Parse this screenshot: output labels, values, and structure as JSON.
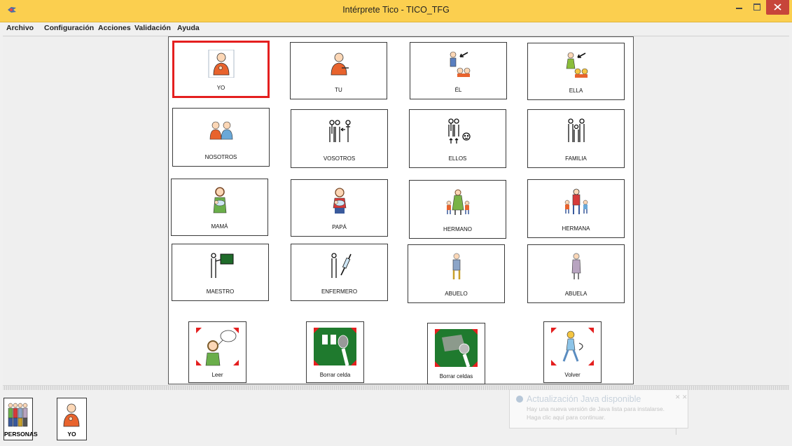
{
  "window": {
    "title": "Intérprete Tico - TICO_TFG"
  },
  "menu": [
    {
      "label": "Archivo"
    },
    {
      "label": "Configuración"
    },
    {
      "label": "Acciones"
    },
    {
      "label": "Validación"
    },
    {
      "label": "Ayuda"
    }
  ],
  "grid": {
    "selected": "YO",
    "cells": [
      {
        "label": "YO",
        "icon": "person-self-icon"
      },
      {
        "label": "TU",
        "icon": "person-you-icon"
      },
      {
        "label": "ÉL",
        "icon": "person-he-icon"
      },
      {
        "label": "ELLA",
        "icon": "person-she-icon"
      },
      {
        "label": "NOSOTROS",
        "icon": "people-we-icon"
      },
      {
        "label": "VOSOTROS",
        "icon": "people-you-plural-icon"
      },
      {
        "label": "ELLOS",
        "icon": "people-they-icon"
      },
      {
        "label": "FAMILIA",
        "icon": "family-icon"
      },
      {
        "label": "MAMÁ",
        "icon": "mother-icon"
      },
      {
        "label": "PAPÁ",
        "icon": "father-icon"
      },
      {
        "label": "HERMANO",
        "icon": "brother-icon"
      },
      {
        "label": "HERMANA",
        "icon": "sister-icon"
      },
      {
        "label": "MAESTRO",
        "icon": "teacher-icon"
      },
      {
        "label": "ENFERMERO",
        "icon": "nurse-icon"
      },
      {
        "label": "ABUELO",
        "icon": "grandfather-icon"
      },
      {
        "label": "ABUELA",
        "icon": "grandmother-icon"
      }
    ],
    "actions": [
      {
        "label": "Leer",
        "icon": "read-aloud-icon"
      },
      {
        "label": "Borrar celda",
        "icon": "delete-cell-icon"
      },
      {
        "label": "Borrar celdas",
        "icon": "delete-cells-icon"
      },
      {
        "label": "Volver",
        "icon": "go-back-icon"
      }
    ]
  },
  "history": [
    {
      "label": "PERSONAS",
      "icon": "people-group-icon"
    },
    {
      "label": "YO",
      "icon": "person-self-icon"
    }
  ],
  "notification": {
    "title": "Actualización Java disponible",
    "line1": "Hay una nueva versión de Java lista para instalarse.",
    "line2": "Haga clic aquí para continuar."
  },
  "colors": {
    "titlebar": "#fbcf4f",
    "selection": "#e41f1f",
    "close_button": "#c7453a"
  }
}
